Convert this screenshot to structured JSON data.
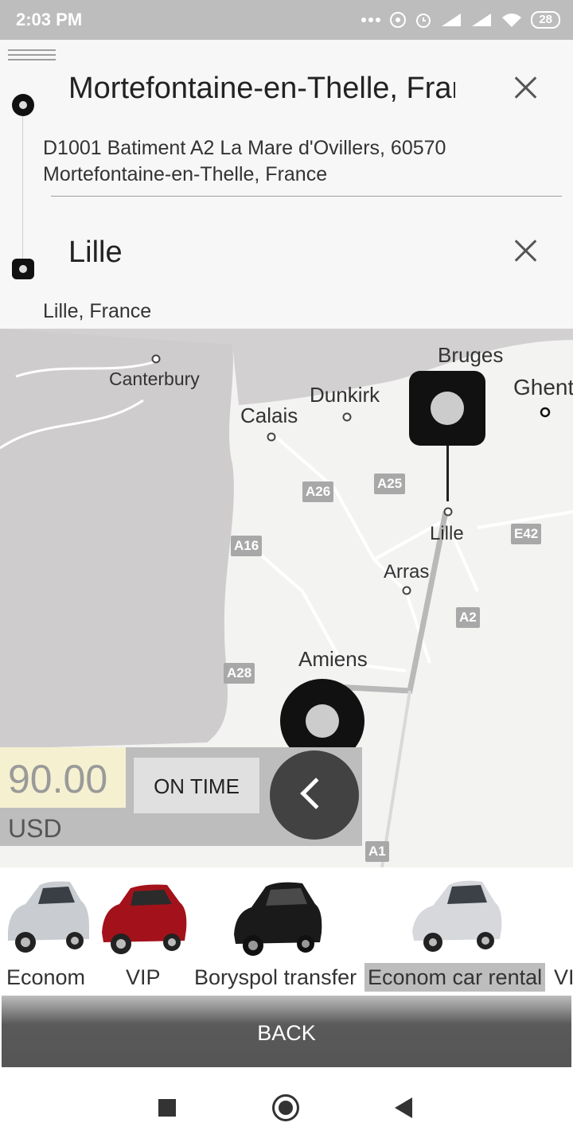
{
  "status_bar": {
    "time": "2:03 PM",
    "battery": "28"
  },
  "route": {
    "from": {
      "title": "Mortefontaine-en-Thelle, France",
      "address_line1": "D1001 Batiment A2 La Mare d'Ovillers, 60570",
      "address_line2": "Mortefontaine-en-Thelle, France"
    },
    "to": {
      "title": "Lille",
      "address": "Lille, France"
    }
  },
  "map": {
    "places": [
      "Bruges",
      "Ghent",
      "Canterbury",
      "Dunkirk",
      "Calais",
      "Lille",
      "Arras",
      "Amiens"
    ],
    "roads": [
      "A26",
      "A25",
      "A16",
      "E42",
      "A2",
      "A28",
      "A1"
    ]
  },
  "fare": {
    "amount": "90.00",
    "currency": "USD",
    "timing_label": "ON TIME"
  },
  "cars": [
    {
      "label": "Econom",
      "color": "#c9cdd2"
    },
    {
      "label": "VIP",
      "color": "#a3121a"
    },
    {
      "label": "Boryspol transfer",
      "color": "#1a1a1a"
    },
    {
      "label": "Econom car rental",
      "color": "#d6d8db"
    },
    {
      "label": "VI"
    }
  ],
  "back_label": "BACK"
}
